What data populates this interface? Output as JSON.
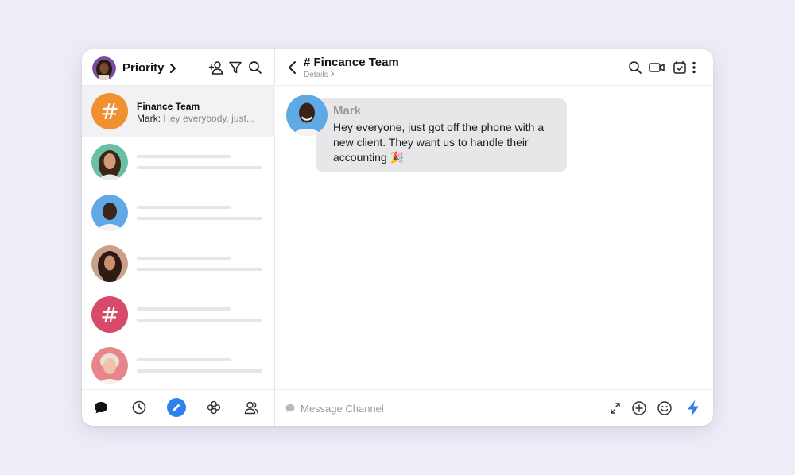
{
  "sidebar": {
    "header": {
      "title": "Priority"
    },
    "conversations": [
      {
        "name": "Finance Team",
        "preview_sender": "Mark:",
        "preview_text": "Hey everybody, just...",
        "color": "#f0902f"
      }
    ],
    "hash_symbol": "#",
    "hash_color_2": "#d84a69"
  },
  "channel": {
    "title": "# Fincance Team",
    "subtitle": "Details",
    "message": {
      "sender": "Mark",
      "text": "Hey everyone, just got off the phone with a new client. They want us to handle their accounting 🎉"
    }
  },
  "composer": {
    "placeholder": "Message Channel"
  },
  "colors": {
    "accent": "#2f80ed",
    "background": "#eeedf7"
  },
  "icons": [
    "add-user-icon",
    "filter-icon",
    "search-icon",
    "back-icon",
    "video-icon",
    "tasks-icon",
    "more-icon",
    "chat-icon",
    "clock-icon",
    "compose-icon",
    "apps-icon",
    "contacts-icon",
    "message-icon",
    "expand-icon",
    "plus-icon",
    "emoji-icon",
    "lightning-icon"
  ]
}
